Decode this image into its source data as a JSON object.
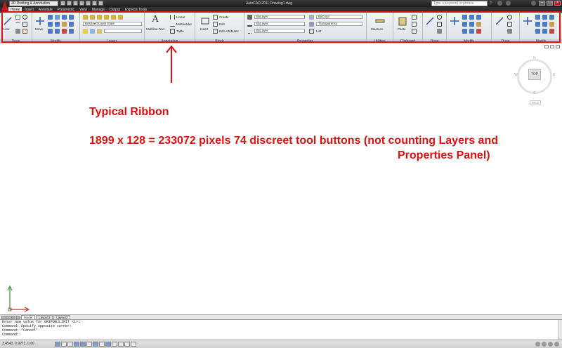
{
  "titlebar": {
    "workspace": "2D Drafting & Annotation",
    "title": "AutoCAD 2011   Drawing1.dwg",
    "search_placeholder": "Type a keyword or phrase"
  },
  "tabs": [
    "Home",
    "Insert",
    "Annotate",
    "Parametric",
    "View",
    "Manage",
    "Output",
    "Express Tools"
  ],
  "ribbon": {
    "panels": [
      {
        "title": "Draw"
      },
      {
        "title": "Modify"
      },
      {
        "title": "Layers"
      },
      {
        "title": "Annotation"
      },
      {
        "title": "Block"
      },
      {
        "title": "Properties"
      },
      {
        "title": "Utilities"
      },
      {
        "title": "Clipboard"
      },
      {
        "title": "Draw"
      },
      {
        "title": "Modify"
      },
      {
        "title": "Draw"
      },
      {
        "title": "Modify"
      }
    ],
    "labels": {
      "line": "Line",
      "move": "Move",
      "multiline_text": "Multiline Text",
      "linear": "Linear",
      "multileader": "Multileader",
      "table": "Table",
      "insert": "Insert",
      "create": "Create",
      "edit": "Edit",
      "edit_attributes": "Edit Attributes",
      "measure": "Measure",
      "paste": "Paste",
      "layer_state": "Unsaved Layer State",
      "bylayer": "ByLayer",
      "byname": "ByLayer",
      "bycolor": "ByColor",
      "transparency": "Transparency",
      "list": "List"
    }
  },
  "annotations": {
    "heading": "Typical Ribbon",
    "line1": "1899 x 128 = 233072 pixels  74 discreet tool buttons  (not counting Layers and",
    "line2": "Properties Panel)"
  },
  "viewcube": {
    "top": "TOP",
    "north": "N",
    "south": "S",
    "east": "E",
    "west": "W",
    "wcs": "WCS"
  },
  "layout_tabs": [
    "Model",
    "Layout1",
    "Layout2"
  ],
  "command_lines": [
    "Enter new value for GRIPOBJLIMIT <1>:",
    "Command: Specify opposite corner:",
    "Command: *Cancel*",
    "Command:"
  ],
  "statusbar": {
    "coords": "3.4543, 0.9273, 0.00"
  },
  "colors": {
    "annotation": "#e01010",
    "ribbon_bg": "#e6e9ed",
    "title_bg": "#2a2a2a"
  }
}
